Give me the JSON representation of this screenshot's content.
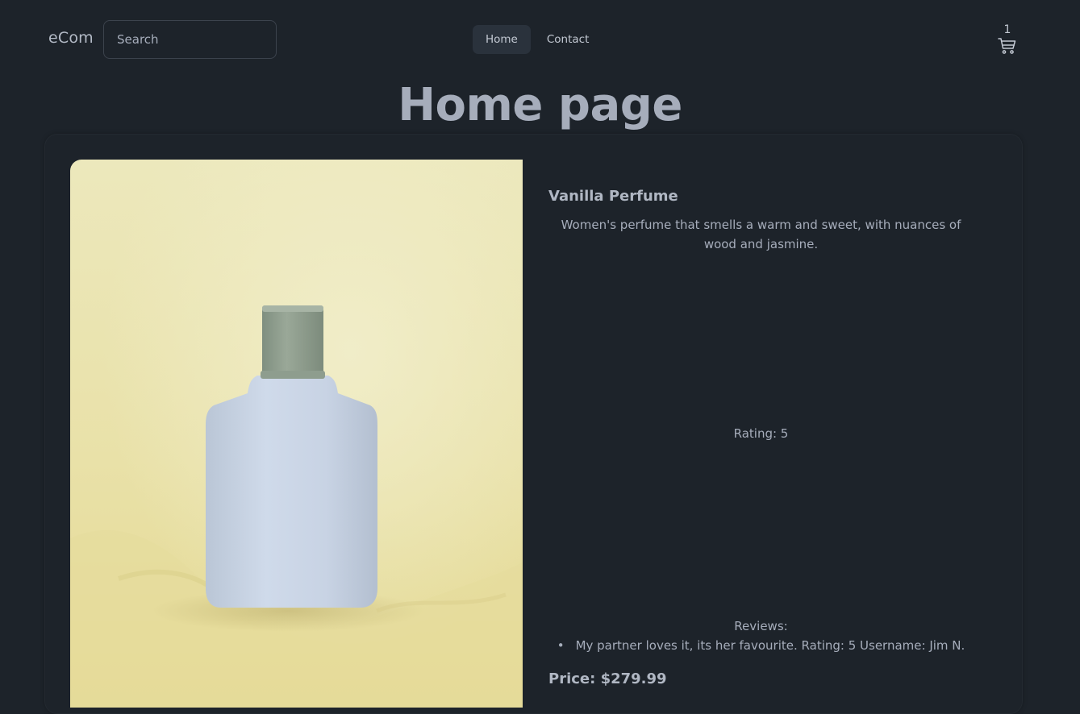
{
  "navbar": {
    "brand": "eCom",
    "search_placeholder": "Search",
    "nav_items": [
      {
        "label": "Home",
        "active": true
      },
      {
        "label": "Contact",
        "active": false
      }
    ],
    "cart_count": "1",
    "cart_icon": "shopping-cart-icon"
  },
  "page": {
    "title": "Home page"
  },
  "product": {
    "name": "Vanilla Perfume",
    "description": "Women's perfume that smells a warm and sweet, with nuances of wood and jasmine.",
    "rating_text": "Rating: 5",
    "reviews_title": "Reviews:",
    "reviews": [
      "My partner loves it, its her favourite. Rating: 5 Username: Jim N."
    ],
    "price_text": "Price: $279.99 ",
    "image": "perfume-bottle-photo"
  },
  "colors": {
    "background": "#1d232a",
    "text": "#a6adbb",
    "active_nav": "#2a323c",
    "image_background": "#ece6b4",
    "bottle": "#c9d4e4",
    "cap": "#8b9a8b"
  }
}
